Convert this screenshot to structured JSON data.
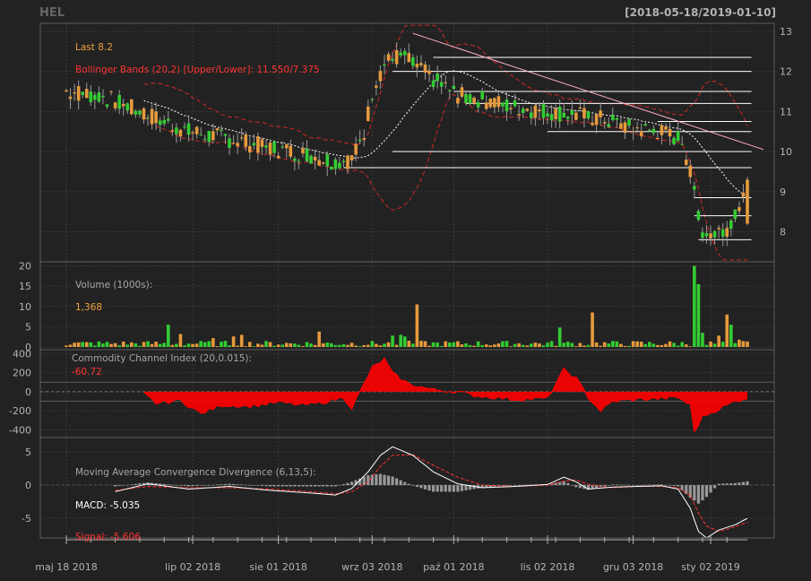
{
  "header": {
    "symbol": "HEL",
    "date_range": "[2018-05-18/2019-01-10]"
  },
  "colors": {
    "background": "#222222",
    "panel_border": "#5c5c5c",
    "grid": "#3a3a3a",
    "axis_text": "#b3b3b3",
    "up_candle": "#33cc33",
    "down_candle": "#e69a3c",
    "bollinger_band": "#d02828",
    "bollinger_mid": "#ffffff",
    "support_line": "#ffffff",
    "trend_line": "#ffb0c8",
    "cci_fill": "#ff0000",
    "macd_line": "#ffffff",
    "signal_line": "#ff3030",
    "macd_hist": "#999999",
    "label_orange": "#f0a23c",
    "label_red": "#ff3333",
    "label_grey": "#a6a6a6"
  },
  "chart_data": [
    {
      "id": "price",
      "type": "candlestick",
      "title": "HEL",
      "legend": {
        "last_label": "Last 8.2",
        "bbands_label": "Bollinger Bands (20,2) [Upper/Lower]: 11.550/7.375"
      },
      "y_ticks": [
        8,
        9,
        10,
        11,
        12,
        13
      ],
      "ylim": [
        7.25,
        13.2
      ],
      "horizontal_levels": [
        {
          "y": 12.35,
          "from": 90,
          "to": 168
        },
        {
          "y": 12.0,
          "from": 80,
          "to": 168
        },
        {
          "y": 11.5,
          "from": 95,
          "to": 168
        },
        {
          "y": 11.2,
          "from": 98,
          "to": 168
        },
        {
          "y": 10.75,
          "from": 145,
          "to": 168
        },
        {
          "y": 10.5,
          "from": 118,
          "to": 168
        },
        {
          "y": 10.0,
          "from": 80,
          "to": 168
        },
        {
          "y": 9.6,
          "from": 68,
          "to": 168
        },
        {
          "y": 8.85,
          "from": 154,
          "to": 168
        },
        {
          "y": 8.4,
          "from": 154,
          "to": 168
        },
        {
          "y": 7.8,
          "from": 155,
          "to": 168
        }
      ],
      "trend_line": {
        "x1": 85,
        "y1": 12.95,
        "x2": 167,
        "y2": 10.05
      }
    },
    {
      "id": "volume",
      "type": "bar",
      "title": "Volume (1000s):",
      "last_value": "1,368",
      "y_ticks": [
        0,
        5,
        10,
        15,
        20
      ],
      "ylim": [
        0,
        21
      ]
    },
    {
      "id": "cci",
      "type": "area",
      "title": "Commodity Channel Index (20,0.015):",
      "last_value": "-60.72",
      "y_ticks": [
        -400,
        -200,
        0,
        200,
        400
      ],
      "ylim": [
        -480,
        440
      ],
      "reference_lines": [
        100,
        -100
      ]
    },
    {
      "id": "macd",
      "type": "line",
      "title": "Moving Average Convergence Divergence (6,13,5):",
      "macd_label": "MACD: -5.035",
      "signal_label": "Signal: -5.606",
      "y_ticks": [
        -5,
        0,
        5
      ],
      "ylim": [
        -8,
        7.2
      ]
    }
  ],
  "x_axis": {
    "n_bars": 168,
    "labels": [
      {
        "text": "maj 18 2018",
        "index": 0
      },
      {
        "text": "lip 02 2018",
        "index": 31
      },
      {
        "text": "sie 01 2018",
        "index": 52
      },
      {
        "text": "wrz 03 2018",
        "index": 75
      },
      {
        "text": "paź 01 2018",
        "index": 95
      },
      {
        "text": "lis 02 2018",
        "index": 118
      },
      {
        "text": "gru 03 2018",
        "index": 139
      },
      {
        "text": "sty 02 2019",
        "index": 158
      }
    ]
  }
}
